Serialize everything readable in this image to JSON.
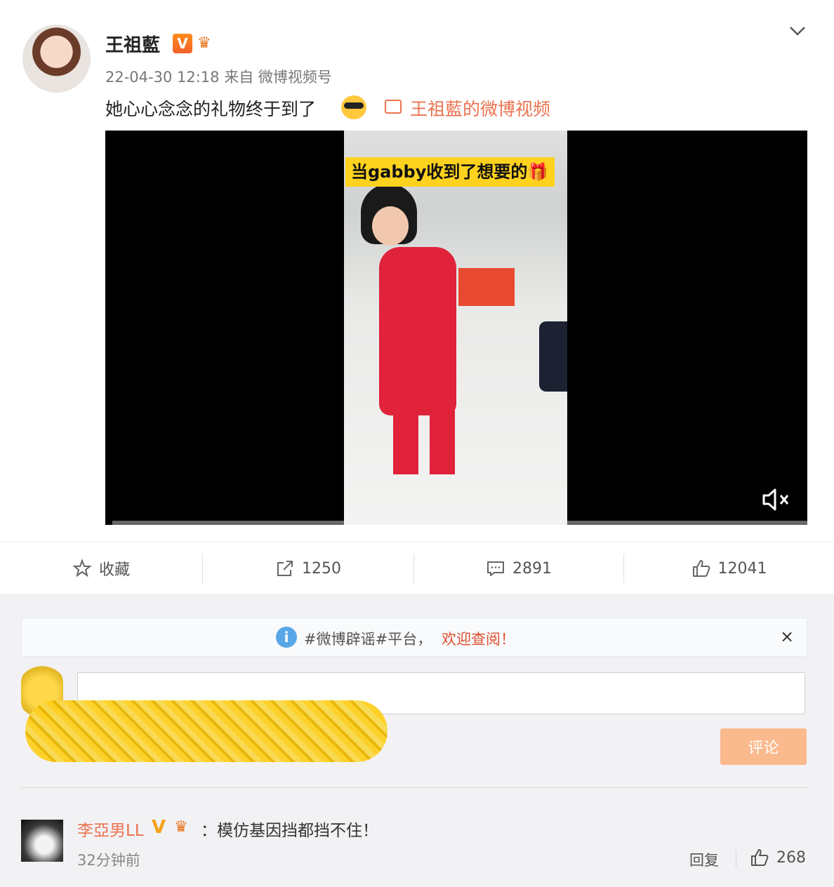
{
  "post": {
    "author": "王祖藍",
    "verified_badge": "V",
    "meta": "22-04-30 12:18 来自 微博视频号",
    "text": "她心心念念的礼物终于到了",
    "video_link": "王祖藍的微博视频",
    "video_caption": "当gabby收到了想要的🎁"
  },
  "actions": {
    "favorite": "收藏",
    "share_count": "1250",
    "comment_count": "2891",
    "like_count": "12041"
  },
  "tip": {
    "part1": "#微博辟谣#平台，",
    "part2": "欢迎查阅！",
    "close": "×"
  },
  "comment_box": {
    "submit": "评论"
  },
  "comment": {
    "name": "李亞男LL",
    "badge": "V",
    "text": "：模仿基因挡都挡不住！",
    "time": "32分钟前",
    "reply": "回复",
    "likes": "268"
  },
  "colors": {
    "accent": "#eb7350",
    "submit_disabled": "#fbb98e",
    "tip_icon": "#5aa7e8"
  }
}
